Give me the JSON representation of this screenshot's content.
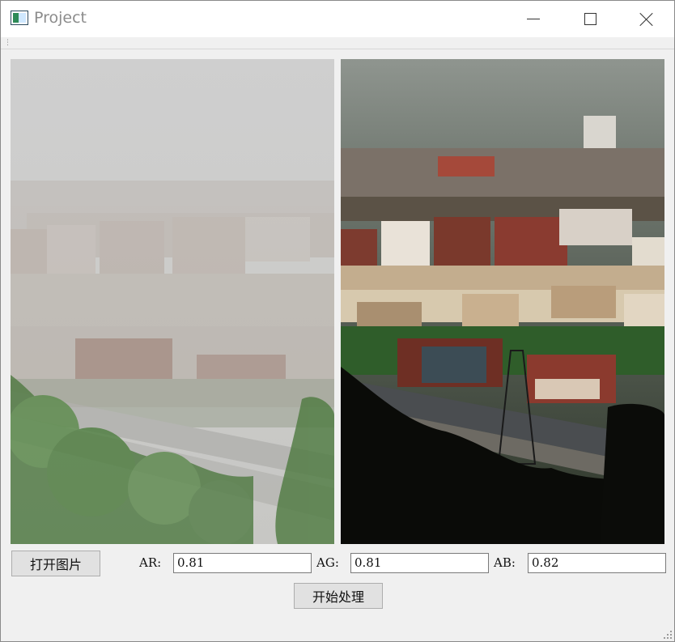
{
  "window": {
    "title": "Project",
    "controls": {
      "minimize": "minimize-icon",
      "maximize": "maximize-icon",
      "close": "close-icon"
    }
  },
  "images": {
    "left": {
      "content": "hazy city photo (input)"
    },
    "right": {
      "content": "dehazed city photo (output)"
    }
  },
  "buttons": {
    "open_image": "打开图片",
    "start_processing": "开始处理"
  },
  "params": {
    "ar_label": "AR:",
    "ar_value": "0.81",
    "ag_label": "AG:",
    "ag_value": "0.81",
    "ab_label": "AB:",
    "ab_value": "0.82"
  },
  "colors": {
    "haze": "#c9c9c9",
    "building_red": "#8b3a2e",
    "foliage": "#2f5d2a"
  }
}
